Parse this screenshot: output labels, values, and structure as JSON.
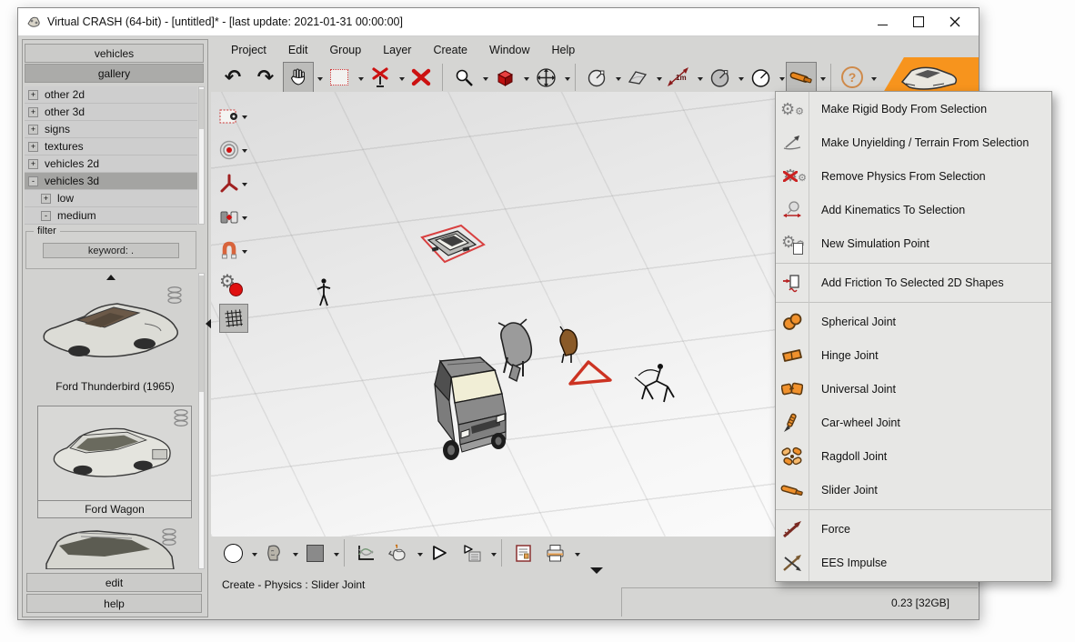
{
  "window": {
    "title": "Virtual CRASH (64-bit) - [untitled]* - [last update: 2021-01-31 00:00:00]"
  },
  "menubar": {
    "items": [
      {
        "label": "Project"
      },
      {
        "label": "Edit"
      },
      {
        "label": "Group"
      },
      {
        "label": "Layer"
      },
      {
        "label": "Create"
      },
      {
        "label": "Window"
      },
      {
        "label": "Help"
      }
    ]
  },
  "sidebar": {
    "tabs": {
      "vehicles": "vehicles",
      "gallery": "gallery"
    },
    "tree": [
      {
        "expander": "+",
        "label": "other 2d"
      },
      {
        "expander": "+",
        "label": "other 3d"
      },
      {
        "expander": "+",
        "label": "signs"
      },
      {
        "expander": "+",
        "label": "textures"
      },
      {
        "expander": "+",
        "label": "vehicles 2d"
      },
      {
        "expander": "-",
        "label": "vehicles 3d"
      },
      {
        "expander": "+",
        "label": "low"
      },
      {
        "expander": "-",
        "label": "medium"
      }
    ],
    "filter": {
      "label": "filter",
      "keyword": "keyword: ."
    },
    "thumbnails": [
      {
        "caption": "Ford Thunderbird (1965)"
      },
      {
        "caption": "Ford Wagon"
      },
      {
        "caption": ""
      }
    ],
    "edit_button": "edit",
    "help_button": "help"
  },
  "toolbar": {
    "measure_label": "1m",
    "help_glyph": "?",
    "icons": [
      "undo",
      "redo",
      "pan-hand",
      "marquee-select",
      "deselect",
      "delete",
      "zoom",
      "cube",
      "move",
      "ball-gauge",
      "plane",
      "measure",
      "gauge-filled",
      "gauge-outline",
      "slider-joint-tool",
      "help",
      "logo-car"
    ]
  },
  "left_toolbar": {
    "icons": [
      "marquee-point",
      "target",
      "axis-tripod",
      "mirror",
      "magnet-snap",
      "physics-gears",
      "grid"
    ]
  },
  "bottom_toolbar": {
    "icons": [
      "circle-shape",
      "head-model",
      "material-swatch",
      "diagram",
      "render-teapot",
      "play",
      "play-sequence",
      "report",
      "print"
    ]
  },
  "popup_menu": {
    "items": [
      {
        "icon": "gears-icon",
        "label": "Make Rigid Body From Selection"
      },
      {
        "icon": "terrain-icon",
        "label": "Make Unyielding / Terrain From Selection"
      },
      {
        "icon": "remove-physics-icon",
        "label": "Remove Physics From Selection"
      },
      {
        "icon": "kinematics-icon",
        "label": "Add Kinematics To Selection"
      },
      {
        "icon": "simulation-point-icon",
        "label": "New Simulation Point"
      },
      {
        "icon": "friction-icon",
        "label": "Add Friction To Selected 2D Shapes"
      },
      {
        "icon": "spherical-joint-icon",
        "label": "Spherical Joint"
      },
      {
        "icon": "hinge-joint-icon",
        "label": "Hinge Joint"
      },
      {
        "icon": "universal-joint-icon",
        "label": "Universal Joint"
      },
      {
        "icon": "car-wheel-joint-icon",
        "label": "Car-wheel Joint"
      },
      {
        "icon": "ragdoll-joint-icon",
        "label": "Ragdoll Joint"
      },
      {
        "icon": "slider-joint-icon",
        "label": "Slider Joint"
      },
      {
        "icon": "force-icon",
        "label": "Force"
      },
      {
        "icon": "ees-impulse-icon",
        "label": "EES Impulse"
      }
    ]
  },
  "statusbar": {
    "mode_text": "Create - Physics : Slider Joint",
    "memory_text": "0.23 [32GB]"
  },
  "viewport": {
    "objects": [
      "selected-car",
      "pedestrian",
      "cow",
      "deer",
      "warning-triangle",
      "cyclist",
      "suv"
    ]
  },
  "colors": {
    "accent_orange": "#f7941d",
    "selection_red": "#d03030",
    "ui_gray": "#d5d5d3"
  }
}
